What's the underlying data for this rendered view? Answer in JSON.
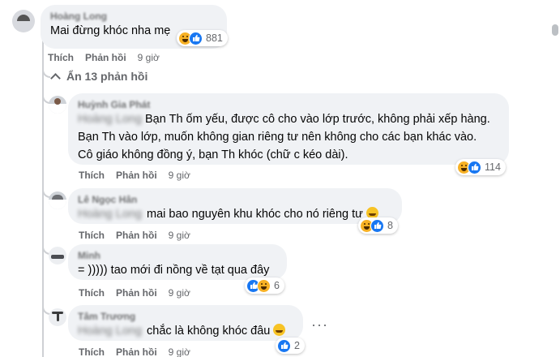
{
  "comments": [
    {
      "id": "c1",
      "author": "Hoàng Long",
      "lines": [
        "Mai đừng khóc nha mẹ"
      ],
      "reactions": {
        "icons": [
          "haha-icon",
          "like-icon"
        ],
        "count": "881"
      },
      "actions": {
        "like": "Thích",
        "reply": "Phản hồi",
        "time": "9 giờ"
      }
    }
  ],
  "hide_replies": "Ẩn 13 phản hồi",
  "replies": [
    {
      "author": "Huỳnh Gia Phát",
      "tag": "Hoàng Long",
      "lines": [
        "Bạn Th ốm yếu, được cô cho vào lớp trước, không phải xếp hàng.",
        "Bạn Th vào lớp, muốn không gian riêng tư nên không cho các bạn khác vào.",
        "Cô giáo không đồng ý, bạn Th khóc (chữ c kéo dài)."
      ],
      "reactions": {
        "icons": [
          "haha-icon",
          "like-icon"
        ],
        "count": "114"
      },
      "actions": {
        "like": "Thích",
        "reply": "Phản hồi",
        "time": "9 giờ"
      }
    },
    {
      "author": "Lê Ngọc Hân",
      "tag": "Hoàng Long",
      "text": "mai bao nguyên khu khóc cho nó riêng tư",
      "reactions": {
        "icons": [
          "haha-icon",
          "like-icon"
        ],
        "count": "8"
      },
      "actions": {
        "like": "Thích",
        "reply": "Phản hồi",
        "time": "9 giờ"
      }
    },
    {
      "author": "Minh",
      "text": "= ))))) tao mới đi nồng về tạt qua đây",
      "reactions": {
        "icons": [
          "like-icon",
          "haha-icon"
        ],
        "count": "6"
      },
      "actions": {
        "like": "Thích",
        "reply": "Phản hồi",
        "time": "9 giờ"
      }
    },
    {
      "author": "Tâm Trương",
      "tag": "Hoàng Long",
      "text": "chắc là không khóc đâu",
      "more": "···",
      "reactions": {
        "icons": [
          "like-icon"
        ],
        "count": "2"
      },
      "actions": {
        "like": "Thích",
        "reply": "Phản hồi",
        "time": "9 giờ"
      }
    }
  ],
  "colors": {
    "bubble": "#f0f2f5",
    "secondary_text": "#65676b",
    "like_blue": "#1877f2",
    "haha_yellow": "#f7b125"
  }
}
